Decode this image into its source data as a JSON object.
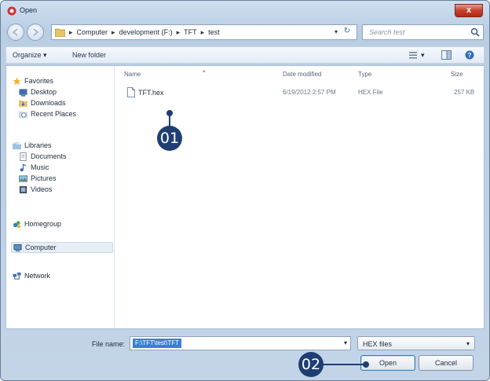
{
  "window": {
    "title": "Open",
    "close_label": "x"
  },
  "address": {
    "crumbs": [
      "Computer",
      "development (F:)",
      "TFT",
      "test"
    ],
    "search_placeholder": "Search test"
  },
  "toolbar": {
    "organize": "Organize ▾",
    "new_folder": "New folder"
  },
  "sidebar": {
    "favorites": "Favorites",
    "desktop": "Desktop",
    "downloads": "Downloads",
    "recent": "Recent Places",
    "libraries": "Libraries",
    "documents": "Documents",
    "music": "Music",
    "pictures": "Pictures",
    "videos": "Videos",
    "homegroup": "Homegroup",
    "computer": "Computer",
    "network": "Network"
  },
  "columns": {
    "name": "Name",
    "date": "Date modified",
    "type": "Type",
    "size": "Size"
  },
  "files": [
    {
      "name": "TFT.hex",
      "date": "6/19/2012 2:57 PM",
      "type": "HEX File",
      "size": "257 KB"
    }
  ],
  "footer": {
    "file_name_label": "File name:",
    "file_name_value": "F:\\TFT\\test\\TFT",
    "file_type": "HEX files",
    "open_label": "Open",
    "cancel_label": "Cancel"
  },
  "callouts": {
    "first": "01",
    "second": "02"
  },
  "colors": {
    "callout": "#1f3f73",
    "selection": "#3b7fd4",
    "close": "#c8402b"
  }
}
